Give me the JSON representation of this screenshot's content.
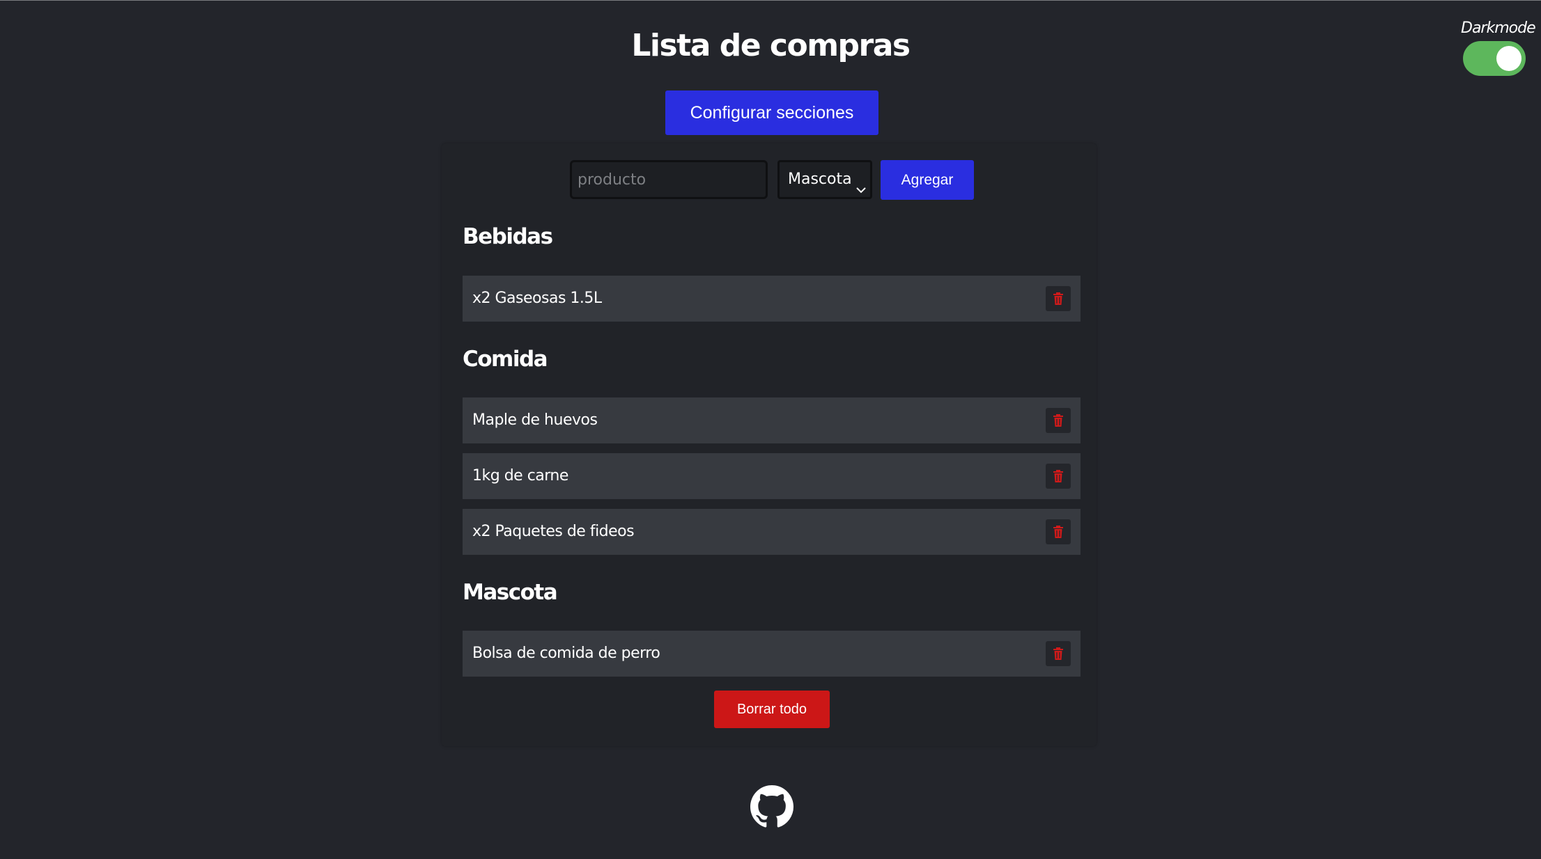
{
  "app": {
    "title": "Lista de compras",
    "darkmode_label": "Darkmode",
    "darkmode_on": true
  },
  "toolbar": {
    "config_label": "Configurar secciones"
  },
  "form": {
    "product_placeholder": "producto",
    "product_value": "",
    "selected_section": "Mascota",
    "add_label": "Agregar"
  },
  "sections": [
    {
      "name": "Bebidas",
      "items": [
        "x2 Gaseosas 1.5L"
      ]
    },
    {
      "name": "Comida",
      "items": [
        "Maple de huevos",
        "1kg de carne",
        "x2 Paquetes de fideos"
      ]
    },
    {
      "name": "Mascota",
      "items": [
        "Bolsa de comida de perro"
      ]
    }
  ],
  "footer": {
    "clear_label": "Borrar todo",
    "github_icon": "github-icon"
  },
  "colors": {
    "background": "#23252b",
    "primary": "#2a2ee0",
    "danger": "#cc1717",
    "toggle_on": "#5db75c",
    "item_bg": "#373a40"
  }
}
